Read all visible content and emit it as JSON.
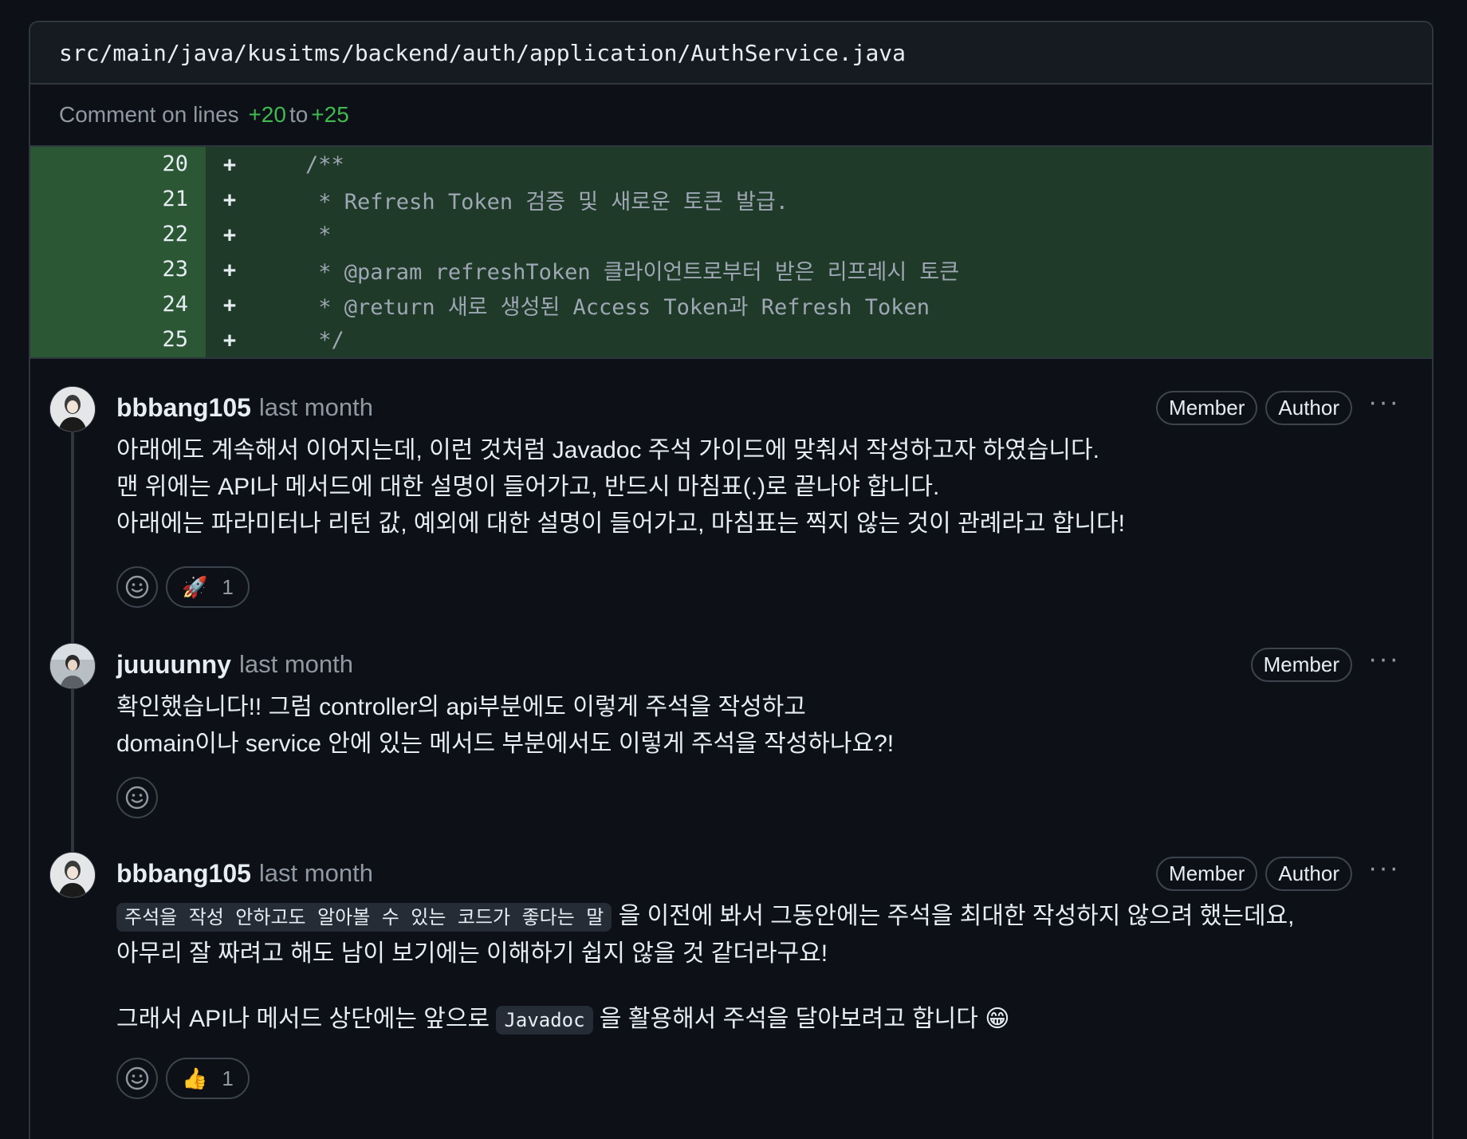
{
  "file": {
    "path": "src/main/java/kusitms/backend/auth/application/AuthService.java"
  },
  "comment_range": {
    "prefix": "Comment on lines",
    "start": "+20",
    "mid": "to",
    "end": "+25"
  },
  "diff": {
    "lines": [
      {
        "num": "20",
        "sign": "+",
        "code": "    /**"
      },
      {
        "num": "21",
        "sign": "+",
        "code": "     * Refresh Token 검증 및 새로운 토큰 발급."
      },
      {
        "num": "22",
        "sign": "+",
        "code": "     *"
      },
      {
        "num": "23",
        "sign": "+",
        "code": "     * @param refreshToken 클라이언트로부터 받은 리프레시 토큰"
      },
      {
        "num": "24",
        "sign": "+",
        "code": "     * @return 새로 생성된 Access Token과 Refresh Token"
      },
      {
        "num": "25",
        "sign": "+",
        "code": "     */"
      }
    ]
  },
  "comments": [
    {
      "author": "bbbang105",
      "time": "last month",
      "badges": [
        "Member",
        "Author"
      ],
      "more": "···",
      "lines": [
        "아래에도 계속해서 이어지는데, 이런 것처럼 Javadoc 주석 가이드에 맞춰서 작성하고자 하였습니다.",
        "맨 위에는 API나 메서드에 대한 설명이 들어가고, 반드시 마침표(.)로 끝나야 합니다.",
        "아래에는 파라미터나 리턴 값, 예외에 대한 설명이 들어가고, 마침표는 찍지 않는 것이 관례라고 합니다!"
      ],
      "reaction": {
        "emoji": "🚀",
        "count": "1"
      }
    },
    {
      "author": "juuuunny",
      "time": "last month",
      "badges": [
        "Member"
      ],
      "more": "···",
      "lines": [
        "확인했습니다!! 그럼 controller의 api부분에도 이렇게 주석을 작성하고",
        "domain이나 service 안에 있는 메서드 부분에서도 이렇게 주석을 작성하나요?!"
      ]
    },
    {
      "author": "bbbang105",
      "time": "last month",
      "badges": [
        "Member",
        "Author"
      ],
      "more": "···",
      "line1_code": "주석을 작성 안하고도 알아볼 수 있는 코드가 좋다는 말",
      "line1_rest": " 을 이전에 봐서 그동안에는 주석을 최대한 작성하지 않으려 했는데요,",
      "line2": "아무리 잘 짜려고 해도 남이 보기에는 이해하기 쉽지 않을 것 같더라구요!",
      "line3_pre": "그래서 API나 메서드 상단에는 앞으로 ",
      "line3_code": "Javadoc",
      "line3_post": " 을 활용해서 주석을 달아보려고 합니다 😁",
      "reaction": {
        "emoji": "👍",
        "count": "1"
      }
    }
  ],
  "icons": {
    "add_reaction": "smiley-icon",
    "more": "kebab-horizontal-icon"
  }
}
